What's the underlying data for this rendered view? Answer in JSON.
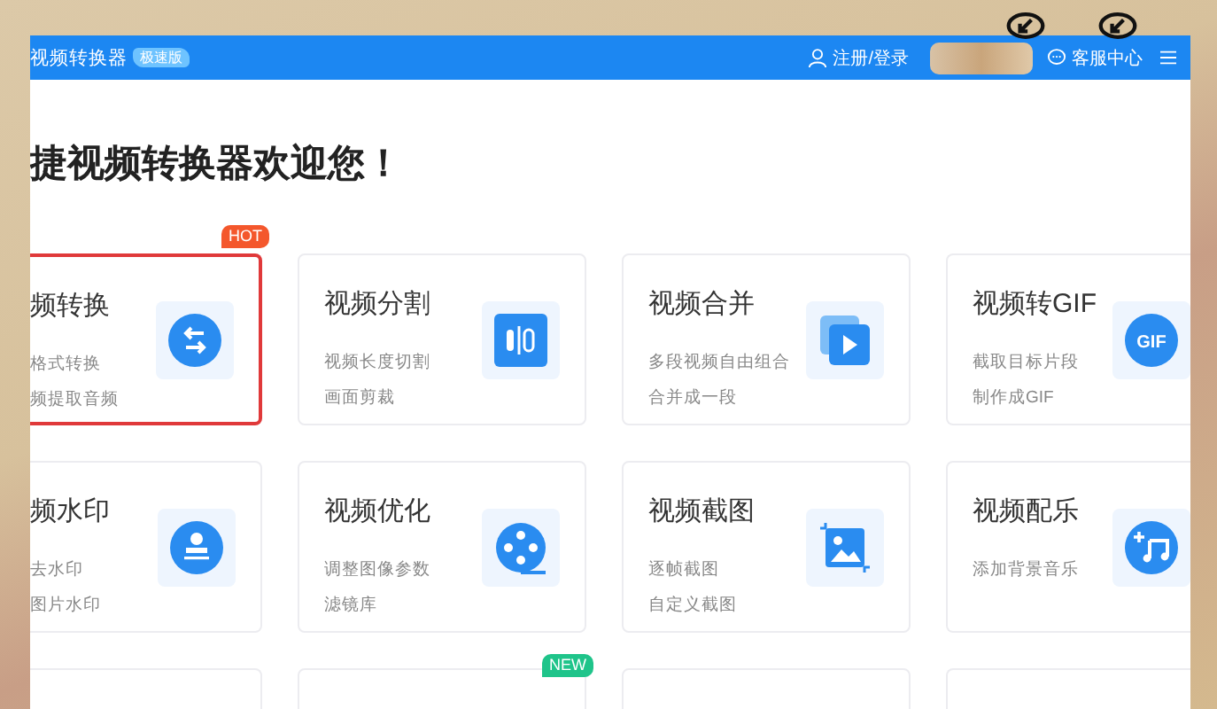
{
  "window": {
    "title": "视频转换器",
    "badge": "极速版",
    "login": "注册/登录",
    "support": "客服中心"
  },
  "heading": "捷视频转换器欢迎您！",
  "cards": [
    {
      "title": "频转换",
      "lines": [
        "格式转换",
        "频提取音频"
      ],
      "badge": "HOT",
      "selected": true
    },
    {
      "title": "视频分割",
      "lines": [
        "视频长度切割",
        "画面剪裁"
      ],
      "selected": false
    },
    {
      "title": "视频合并",
      "lines": [
        "多段视频自由组合",
        "合并成一段"
      ],
      "selected": false
    },
    {
      "title": "视频转GIF",
      "lines": [
        "截取目标片段",
        "制作成GIF"
      ],
      "icon_text": "GIF",
      "selected": false
    },
    {
      "title": "频水印",
      "lines": [
        "去水印",
        "图片水印"
      ],
      "selected": false
    },
    {
      "title": "视频优化",
      "lines": [
        "调整图像参数",
        "滤镜库"
      ],
      "selected": false
    },
    {
      "title": "视频截图",
      "lines": [
        "逐帧截图",
        "自定义截图"
      ],
      "selected": false
    },
    {
      "title": "视频配乐",
      "lines": [
        "添加背景音乐"
      ],
      "selected": false
    }
  ],
  "cut_cards": [
    {
      "selected": false
    },
    {
      "selected": false,
      "badge": "NEW"
    },
    {
      "selected": false
    },
    {
      "selected": false
    }
  ]
}
